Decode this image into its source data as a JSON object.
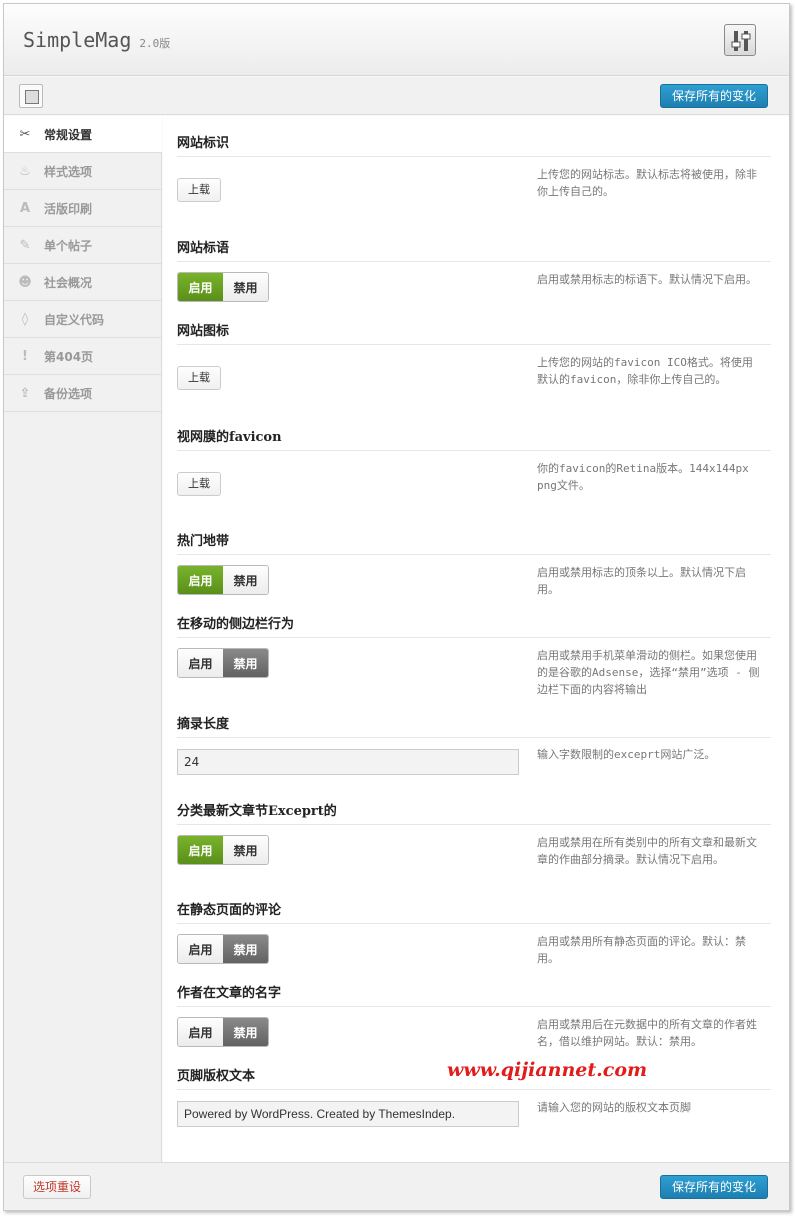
{
  "header": {
    "brand": "SimpleMag",
    "version": "2.0版",
    "settings_icon": "sliders-icon"
  },
  "toolbar": {
    "layout_icon": "layout-icon",
    "save_label": "保存所有的变化"
  },
  "sidebar": {
    "items": [
      {
        "label": "常规设置",
        "icon": "tools-icon",
        "glyph": "✂"
      },
      {
        "label": "样式选项",
        "icon": "paint-icon",
        "glyph": "♨"
      },
      {
        "label": "活版印刷",
        "icon": "typography-icon",
        "glyph": "A"
      },
      {
        "label": "单个帖子",
        "icon": "pin-icon",
        "glyph": "✎"
      },
      {
        "label": "社会概况",
        "icon": "social-icon",
        "glyph": "☻"
      },
      {
        "label": "自定义代码",
        "icon": "code-icon",
        "glyph": "◊"
      },
      {
        "label": "第404页",
        "icon": "warning-icon",
        "glyph": "!"
      },
      {
        "label": "备份选项",
        "icon": "backup-icon",
        "glyph": "⇪"
      }
    ]
  },
  "sections": {
    "logo": {
      "title": "网站标识",
      "button": "上载",
      "desc": "上传您的网站标志。默认标志将被使用，除非你上传自己的。"
    },
    "tagline": {
      "title": "网站标语",
      "on": "启用",
      "off": "禁用",
      "state": "on",
      "desc": "启用或禁用标志的标语下。默认情况下启用。"
    },
    "favicon": {
      "title": "网站图标",
      "button": "上载",
      "desc": "上传您的网站的favicon ICO格式。将使用默认的favicon，除非你上传自己的。"
    },
    "retina_favicon": {
      "title": "视网膜的favicon",
      "button": "上载",
      "desc": "你的favicon的Retina版本。144x144px png文件。"
    },
    "hot_topics": {
      "title": "热门地带",
      "on": "启用",
      "off": "禁用",
      "state": "on",
      "desc": "启用或禁用标志的顶条以上。默认情况下启用。"
    },
    "mobile_sidebar": {
      "title": "在移动的侧边栏行为",
      "on": "启用",
      "off": "禁用",
      "state": "off",
      "desc": "启用或禁用手机菜单滑动的侧栏。如果您使用的是谷歌的Adsense，选择“禁用”选项 - 侧边栏下面的内容将输出"
    },
    "excerpt_length": {
      "title": "摘录长度",
      "value": "24",
      "desc": "输入字数限制的exceprt网站广泛。"
    },
    "category_excerpt": {
      "title": "分类最新文章节Exceprt的",
      "on": "启用",
      "off": "禁用",
      "state": "on",
      "desc": "启用或禁用在所有类别中的所有文章和最新文章的作曲部分摘录。默认情况下启用。"
    },
    "page_comments": {
      "title": "在静态页面的评论",
      "on": "启用",
      "off": "禁用",
      "state": "off",
      "desc": "启用或禁用所有静态页面的评论。默认：禁用。"
    },
    "author_name": {
      "title": "作者在文章的名字",
      "on": "启用",
      "off": "禁用",
      "state": "off",
      "desc": "启用或禁用后在元数据中的所有文章的作者姓名，借以维护网站。默认：禁用。"
    },
    "copyright": {
      "title": "页脚版权文本",
      "value": "Powered by WordPress. Created by ThemesIndep.",
      "desc": "请输入您的网站的版权文本页脚"
    }
  },
  "watermark": "www.qijiannet.com",
  "footer": {
    "reset_label": "选项重设",
    "save_label": "保存所有的变化"
  }
}
